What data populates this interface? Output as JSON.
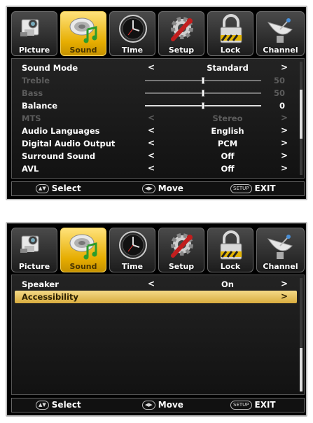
{
  "screens": [
    {
      "tabs": [
        {
          "label": "Picture",
          "icon": "camcorder-icon"
        },
        {
          "label": "Sound",
          "icon": "speaker-music-note-icon"
        },
        {
          "label": "Time",
          "icon": "clock-icon"
        },
        {
          "label": "Setup",
          "icon": "gear-wrench-icon"
        },
        {
          "label": "Lock",
          "icon": "padlock-icon"
        },
        {
          "label": "Channel",
          "icon": "satellite-dish-icon"
        }
      ],
      "active_tab": "Sound",
      "rows": [
        {
          "label": "Sound Mode",
          "value": "Standard",
          "type": "select",
          "enabled": true
        },
        {
          "label": "Treble",
          "value": "50",
          "level": 0.5,
          "type": "slider",
          "enabled": false
        },
        {
          "label": "Bass",
          "value": "50",
          "level": 0.5,
          "type": "slider",
          "enabled": false
        },
        {
          "label": "Balance",
          "value": "0",
          "level": 0.5,
          "type": "slider",
          "enabled": true
        },
        {
          "label": "MTS",
          "value": "Stereo",
          "type": "select",
          "enabled": false
        },
        {
          "label": "Audio Languages",
          "value": "English",
          "type": "select",
          "enabled": true
        },
        {
          "label": "Digital Audio Output",
          "value": "PCM",
          "type": "select",
          "enabled": true
        },
        {
          "label": "Surround Sound",
          "value": "Off",
          "type": "select",
          "enabled": true
        },
        {
          "label": "AVL",
          "value": "Off",
          "type": "select",
          "enabled": true
        }
      ],
      "footer": {
        "select_icon": "up-down-buttons-icon",
        "select_label": "Select",
        "move_icon": "left-right-buttons-icon",
        "move_label": "Move",
        "setup_button": "SETUP",
        "exit_label": "EXIT"
      }
    },
    {
      "tabs": [
        {
          "label": "Picture",
          "icon": "camcorder-icon"
        },
        {
          "label": "Sound",
          "icon": "speaker-music-note-icon"
        },
        {
          "label": "Time",
          "icon": "clock-icon"
        },
        {
          "label": "Setup",
          "icon": "gear-wrench-icon"
        },
        {
          "label": "Lock",
          "icon": "padlock-icon"
        },
        {
          "label": "Channel",
          "icon": "satellite-dish-icon"
        }
      ],
      "active_tab": "Sound",
      "rows": [
        {
          "label": "Speaker",
          "value": "On",
          "type": "select",
          "enabled": true
        },
        {
          "label": "Accessibility",
          "value": "",
          "type": "submenu",
          "enabled": true,
          "highlighted": true
        }
      ],
      "footer": {
        "select_icon": "up-down-buttons-icon",
        "select_label": "Select",
        "move_icon": "left-right-buttons-icon",
        "move_label": "Move",
        "setup_button": "SETUP",
        "exit_label": "EXIT"
      }
    }
  ],
  "colors": {
    "active_tab": "#e6ad00",
    "highlight_row": "#d9ad3f",
    "background": "#000000"
  }
}
